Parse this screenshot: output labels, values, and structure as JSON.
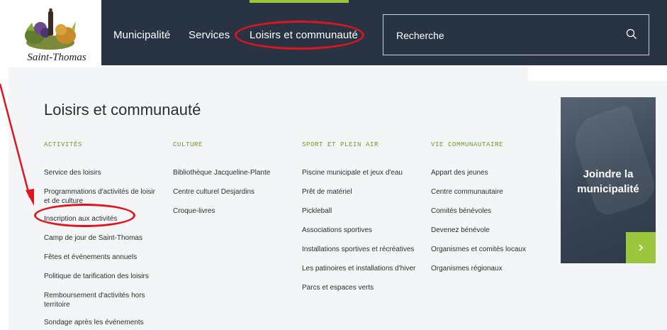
{
  "brand": {
    "name": "Saint-Thomas"
  },
  "nav": {
    "items": [
      "Municipalité",
      "Services",
      "Loisirs et communauté"
    ],
    "search_label": "Recherche"
  },
  "menu": {
    "title": "Loisirs et communauté",
    "columns": [
      {
        "heading": "ACTIVITÉS",
        "items": [
          "Service des loisirs",
          "Programmations d'activités de loisir et de culture",
          "Inscription aux activités",
          "Camp de jour de Saint-Thomas",
          "Fêtes et événements annuels",
          "Politique de tarification des loisirs",
          "Remboursement d'activités hors territoire",
          "Sondage après les événements"
        ]
      },
      {
        "heading": "CULTURE",
        "items": [
          "Bibliothèque Jacqueline-Plante",
          "Centre culturel Desjardins",
          "Croque-livres"
        ]
      },
      {
        "heading": "SPORT ET PLEIN AIR",
        "items": [
          "Piscine municipale et jeux d'eau",
          "Prêt de matériel",
          "Pickleball",
          "Associations sportives",
          "Installations sportives et récréatives",
          "Les patinoires et installations d'hiver",
          "Parcs et espaces verts"
        ]
      },
      {
        "heading": "VIE COMMUNAUTAIRE",
        "items": [
          "Appart des jeunes",
          "Centre communautaire",
          "Comités bénévoles",
          "Devenez bénévole",
          "Organismes et comités locaux",
          "Organismes régionaux"
        ]
      }
    ]
  },
  "promo": {
    "title": "Joindre la municipalité"
  },
  "colors": {
    "nav_bg": "#283444",
    "accent_green": "#9cc63b",
    "annotation_red": "#e0141e",
    "panel_bg": "#f4f5f6"
  },
  "icons": [
    "logo-emblem",
    "search-icon",
    "chevron-right-icon",
    "annotation-arrow"
  ]
}
